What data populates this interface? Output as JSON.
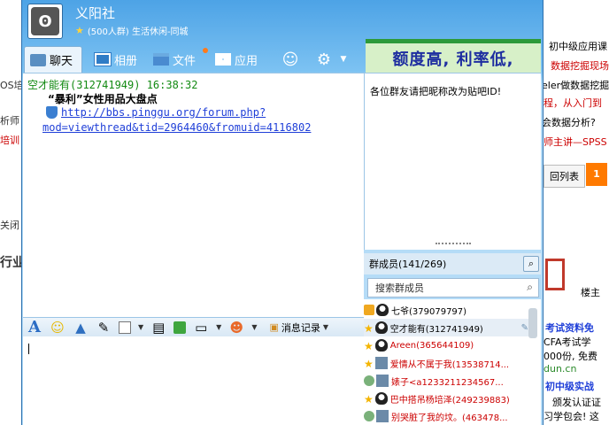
{
  "background": {
    "left_fragments": [
      "OS培",
      "析师",
      "培训",
      "关闭",
      "行业"
    ],
    "right_fragments": [
      {
        "text": "初中级应用课",
        "color": "#333333"
      },
      {
        "text": "数据挖掘现场",
        "color": "#cc0000"
      },
      {
        "text": "eler做数据挖掘",
        "color": "#333333"
      },
      {
        "text": "程，从入门到",
        "color": "#cc0000"
      },
      {
        "text": "会数据分析?",
        "color": "#333333"
      },
      {
        "text": "师主讲—SPSS",
        "color": "#cc0000"
      },
      {
        "text": "回列表",
        "color": "#333333"
      },
      {
        "text": "1",
        "color": "#ffffff"
      },
      {
        "text": "楼主",
        "color": "#333333"
      },
      {
        "text": "考试资料免",
        "color": "#1f3fd8"
      },
      {
        "text": "CFA考试学",
        "color": "#333333"
      },
      {
        "text": "000份, 免费",
        "color": "#333333"
      },
      {
        "text": "dun.cn",
        "color": "#2a8a2a"
      },
      {
        "text": "初中级实战",
        "color": "#1f3fd8"
      },
      {
        "text": "颁发认证证",
        "color": "#333333"
      },
      {
        "text": "习学包会! 这",
        "color": "#333333"
      }
    ]
  },
  "header": {
    "group_name": "义阳社",
    "meta": "(500人群) 生活休闲-同城"
  },
  "tabs": [
    {
      "label": "聊天",
      "icon": "chat-icon"
    },
    {
      "label": "相册",
      "icon": "album-icon"
    },
    {
      "label": "文件",
      "icon": "folder-icon"
    },
    {
      "label": "应用",
      "icon": "apps-icon"
    }
  ],
  "ad": {
    "text": "额度高, 利率低,"
  },
  "chat": {
    "sender_line": "空才能有(312741949)  16:38:32",
    "title": "“暴利”女性用品大盘点",
    "link_part1": "http://bbs.pinggu.org/forum.php?",
    "link_part2": "mod=viewthread&tid=2964460&fromuid=4116802"
  },
  "notice": {
    "text": "各位群友请把昵称改为贴吧ID!"
  },
  "members": {
    "header": "群成员(141/269)",
    "search_placeholder": "搜索群成员",
    "list": [
      {
        "name": "七爷(379079797)",
        "color": "#000000",
        "badge": "crown"
      },
      {
        "name": "空才能有(312741949)",
        "color": "#000000",
        "badge": "star"
      },
      {
        "name": "Areen(365644109)",
        "color": "#cc0000",
        "badge": "star"
      },
      {
        "name": "爱情从不属于我(13538714...",
        "color": "#cc0000",
        "badge": "star"
      },
      {
        "name": "婊子<a1233211234567...",
        "color": "#cc0000",
        "badge": "chat"
      },
      {
        "name": "巴中搭吊杨培泽(249239883)",
        "color": "#cc0000",
        "badge": "star"
      },
      {
        "name": "别哭脏了我的坟。(463478...",
        "color": "#cc0000",
        "badge": "chat"
      }
    ]
  },
  "toolbar": {
    "history_label": "消息记录"
  }
}
